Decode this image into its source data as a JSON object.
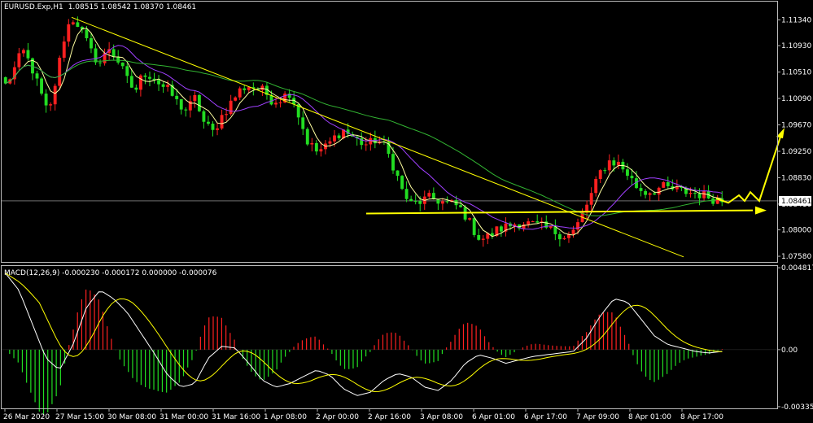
{
  "header": {
    "symbol_label": "EURUSD.Exp,H1",
    "ohlc_label": "1.08515 1.08542 1.08370 1.08461"
  },
  "indicator": {
    "label": "MACD(12,26,9) -0.000230 -0.000172 0.000000 -0.000076"
  },
  "colors": {
    "background": "#000000",
    "bull": "#ff2020",
    "bear": "#22dd22",
    "ma_fast": "#ffffa0",
    "ma_slow": "#a040ff",
    "ma_long": "#32b432",
    "trendline": "#ffff00",
    "forecast": "#ffff00",
    "macd_line": "#ffffff",
    "signal_line": "#ffff00",
    "grid": "#b4b4b4"
  },
  "chart_data": [
    {
      "type": "candlestick",
      "series": [
        {
          "name": "EURUSD.Exp,H1"
        }
      ],
      "price_axis": {
        "ticks": [
          1.1134,
          1.1093,
          1.1051,
          1.1009,
          1.0967,
          1.0925,
          1.0883,
          1.0841,
          1.08,
          1.0758
        ],
        "tick_labels": [
          "1.11340",
          "1.10930",
          "1.10510",
          "1.10090",
          "1.09670",
          "1.09250",
          "1.08830",
          "1.08410",
          "1.08000",
          "1.07580"
        ],
        "current_price": "1.08461",
        "ylim": [
          1.0749,
          1.1163
        ]
      },
      "time_axis": {
        "labels": [
          "26 Mar 2020",
          "27 Mar 15:00",
          "30 Mar 08:00",
          "31 Mar 00:00",
          "31 Mar 16:00",
          "1 Apr 08:00",
          "2 Apr 00:00",
          "2 Apr 16:00",
          "3 Apr 08:00",
          "6 Apr 01:00",
          "6 Apr 17:00",
          "7 Apr 09:00",
          "8 Apr 01:00",
          "8 Apr 17:00"
        ]
      },
      "trendline_price": {
        "start": 1.1138,
        "end": 1.0757
      },
      "support_price": 1.0826,
      "forecast_prices": [
        1.085,
        1.0843,
        1.0855,
        1.0846,
        1.086,
        1.0846,
        1.0952
      ],
      "support_target_price": 1.0831,
      "path_prices": [
        1.103,
        1.1055,
        1.1085,
        1.106,
        1.102,
        1.098,
        1.105,
        1.112,
        1.1138,
        1.111,
        1.108,
        1.1065,
        1.109,
        1.107,
        1.104,
        1.102,
        1.105,
        1.1045,
        1.103,
        1.102,
        1.1,
        1.099,
        1.101,
        1.097,
        1.0955,
        1.098,
        1.1,
        1.102,
        1.103,
        1.1025,
        1.102,
        1.1005,
        1.101,
        1.102,
        1.098,
        1.094,
        1.0925,
        1.093,
        1.0945,
        1.096,
        1.095,
        1.094,
        1.0935,
        1.0945,
        1.093,
        1.09,
        1.086,
        1.084,
        1.0845,
        1.085,
        1.0848,
        1.0842,
        1.084,
        1.083,
        1.0805,
        1.0785,
        1.079,
        1.08,
        1.0805,
        1.081,
        1.0812,
        1.0808,
        1.0805,
        1.08,
        1.0795,
        1.079,
        1.08,
        1.083,
        1.086,
        1.0895,
        1.091,
        1.0905,
        1.089,
        1.087,
        1.086,
        1.0862,
        1.0868,
        1.0865,
        1.0862,
        1.086,
        1.0858,
        1.0855,
        1.085,
        1.0846
      ]
    },
    {
      "type": "histogram",
      "series": [
        {
          "name": "MACD(12,26,9)"
        }
      ],
      "value_axis": {
        "ticks": [
          0.004817,
          0.0,
          -0.003351
        ],
        "tick_labels": [
          "0.004817",
          "0.00",
          "-0.003351"
        ],
        "ylim": [
          -0.00345,
          0.00492
        ]
      },
      "macd_values": [
        0.0045,
        0.0035,
        0.0015,
        -0.0005,
        -0.0012,
        0.0003,
        0.0025,
        0.0035,
        0.003,
        0.0022,
        0.001,
        -0.0002,
        -0.0015,
        -0.0022,
        -0.002,
        -0.0005,
        0.0002,
        0.0001,
        -0.0008,
        -0.0018,
        -0.0022,
        -0.002,
        -0.0016,
        -0.0012,
        -0.0015,
        -0.0023,
        -0.0027,
        -0.0025,
        -0.0018,
        -0.0014,
        -0.0016,
        -0.0022,
        -0.0024,
        -0.0018,
        -0.0008,
        -0.0003,
        -0.0005,
        -0.0008,
        -0.0006,
        -0.0004,
        -0.0003,
        -0.0002,
        -0.0001,
        0.0007,
        0.002,
        0.003,
        0.0028,
        0.0018,
        0.0008,
        0.0003,
        0.0001,
        -0.0001,
        -0.0002,
        -0.0001
      ]
    }
  ]
}
